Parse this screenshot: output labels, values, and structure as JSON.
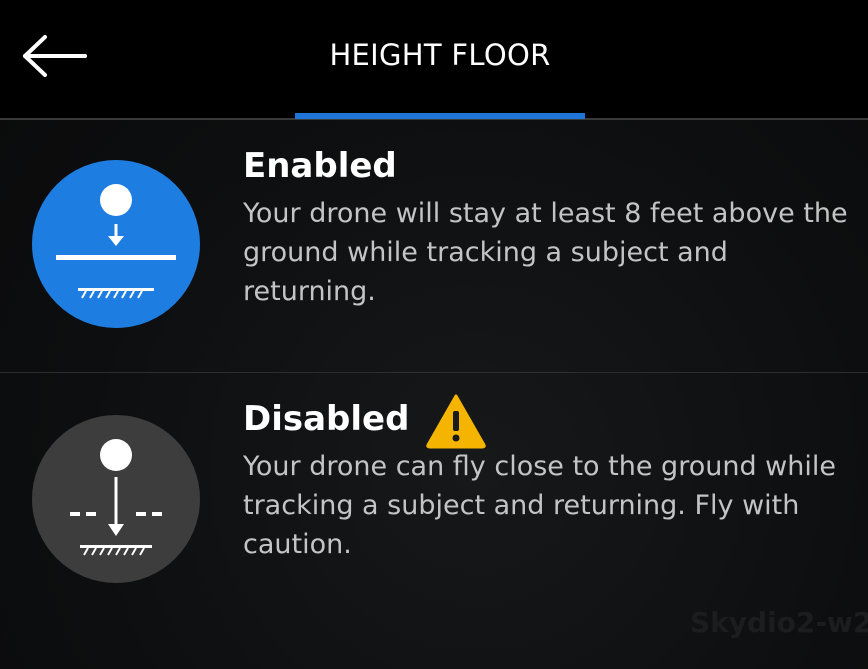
{
  "header": {
    "title": "HEIGHT FLOOR",
    "back_icon": "arrow-left-icon",
    "accent_color": "#1e76d6"
  },
  "options": [
    {
      "title": "Enabled",
      "description": "Your drone will stay at least 8 feet above the ground while tracking a subject and returning.",
      "icon": "height-floor-enabled-icon",
      "selected": true,
      "circle_color": "#1e7de0"
    },
    {
      "title": "Disabled",
      "description": "Your drone can fly close to the ground while tracking a subject and returning. Fly with caution.",
      "icon": "height-floor-disabled-icon",
      "warning_icon": "warning-icon",
      "selected": false,
      "circle_color": "#3d3d3d"
    }
  ],
  "watermark": "Skydio2-w2"
}
